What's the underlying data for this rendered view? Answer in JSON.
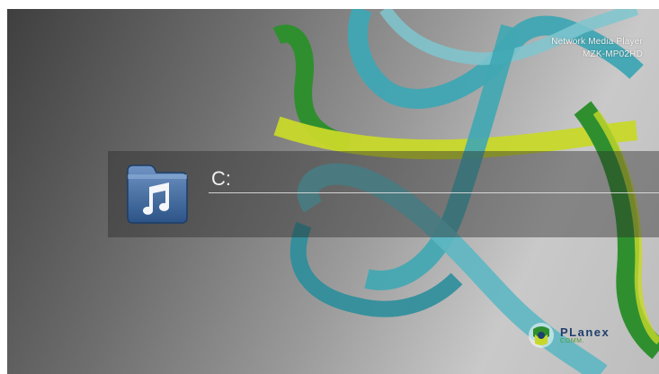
{
  "product": {
    "line1": "Network Media Player",
    "line2": "MZK-MP02HD"
  },
  "browser": {
    "folder_icon": "music-note-icon",
    "path": "C:"
  },
  "brand": {
    "name": "PLanex",
    "sub": "COMM."
  },
  "colors": {
    "teal_ribbon": "#3fa7b3",
    "green_ribbon": "#2f8f2f",
    "lime_ribbon": "#c8d82a",
    "folder_blue": "#3d6a9e"
  }
}
